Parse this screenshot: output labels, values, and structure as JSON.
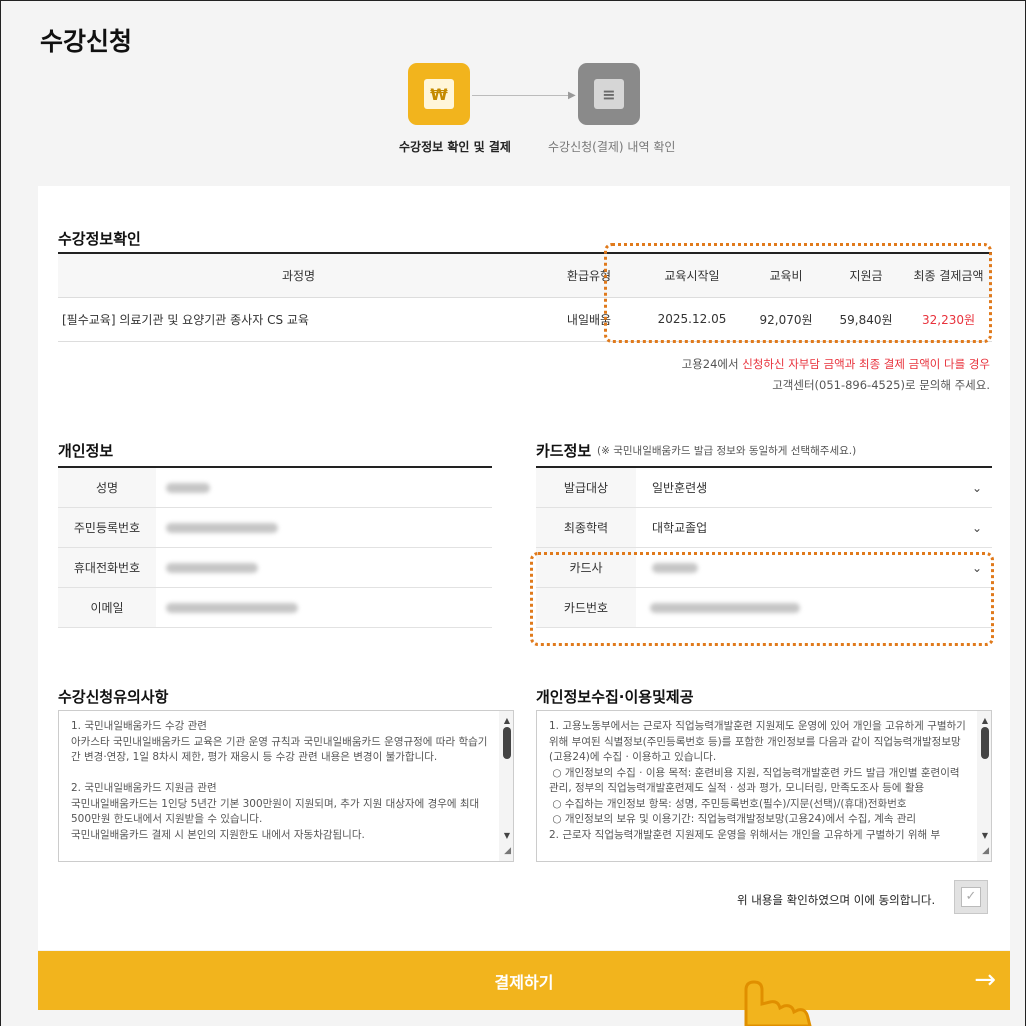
{
  "page": {
    "title": "수강신청"
  },
  "steps": [
    {
      "label": "수강정보 확인 및 결제",
      "icon": "won-icon",
      "glyph": "₩",
      "active": true
    },
    {
      "label": "수강신청(결제) 내역 확인",
      "icon": "document-icon",
      "glyph": "≡",
      "active": false
    }
  ],
  "course_section": {
    "title": "수강정보확인",
    "columns": [
      "과정명",
      "환급유형",
      "교육시작일",
      "교육비",
      "지원금",
      "최종 결제금액"
    ],
    "row": {
      "course_name": "[필수교육] 의료기관 및 요양기관 종사자 CS 교육",
      "refund_type": "내일배움",
      "start_date": "2025.12.05",
      "fee": "92,070원",
      "subsidy": "59,840원",
      "final_amount": "32,230원"
    },
    "notice_prefix": "고용24에서 ",
    "notice_highlight": "신청하신 자부담 금액과 최종 결제 금액이 다를 경우",
    "notice_line2": "고객센터(051-896-4525)로 문의해 주세요."
  },
  "personal_section": {
    "title": "개인정보",
    "labels": [
      "성명",
      "주민등록번호",
      "휴대전화번호",
      "이메일"
    ]
  },
  "card_section": {
    "title": "카드정보",
    "note": "(※ 국민내일배움카드 발급 정보와 동일하게 선택해주세요.)",
    "issue_target_label": "발급대상",
    "issue_target_value": "일반훈련생",
    "education_label": "최종학력",
    "education_value": "대학교졸업",
    "card_company_label": "카드사",
    "card_number_label": "카드번호"
  },
  "notice_section": {
    "title": "수강신청유의사항",
    "text": "1. 국민내일배움카드 수강 관련\n아카스타 국민내일배움카드 교육은 기관 운영 규칙과 국민내일배움카드 운영규정에 따라 학습기간 변경·연장, 1일 8차시 제한, 평가 재응시 등 수강 관련 내용은 변경이 불가합니다.\n\n2. 국민내일배움카드 지원금 관련\n국민내일배움카드는 1인당 5년간 기본 300만원이 지원되며, 추가 지원 대상자에 경우에 최대 500만원 한도내에서 지원받을 수 있습니다.\n국민내일배움카드 결제 시 본인의 지원한도 내에서 자동차감됩니다."
  },
  "privacy_section": {
    "title": "개인정보수집·이용및제공",
    "text": "1. 고용노동부에서는 근로자 직업능력개발훈련 지원제도 운영에 있어 개인을 고유하게 구별하기 위해 부여된 식별정보(주민등록번호 등)를 포함한 개인정보를 다음과 같이 직업능력개발정보망(고용24)에 수집 · 이용하고 있습니다.\n ○ 개인정보의 수집 · 이용 목적: 훈련비용 지원, 직업능력개발훈련 카드 발급 개인별 훈련이력 관리, 정부의 직업능력개발훈련제도 실적 · 성과 평가, 모니터링, 만족도조사 등에 활용\n ○ 수집하는 개인정보 항목: 성명, 주민등록번호(필수)/지문(선택)/(휴대)전화번호\n ○ 개인정보의 보유 및 이용기간: 직업능력개발정보망(고용24)에서 수집, 계속 관리\n2. 근로자 직업능력개발훈련 지원제도 운영을 위해서는 개인을 고유하게 구별하기 위해 부"
  },
  "agree": {
    "label": "위 내용을 확인하였으며 이에 동의합니다.",
    "checked": false
  },
  "pay_button": {
    "label": "결제하기",
    "arrow": "→"
  },
  "colors": {
    "accent": "#f2b41d",
    "highlight_red": "#e8323c",
    "dotted_orange": "#e07a1c"
  }
}
